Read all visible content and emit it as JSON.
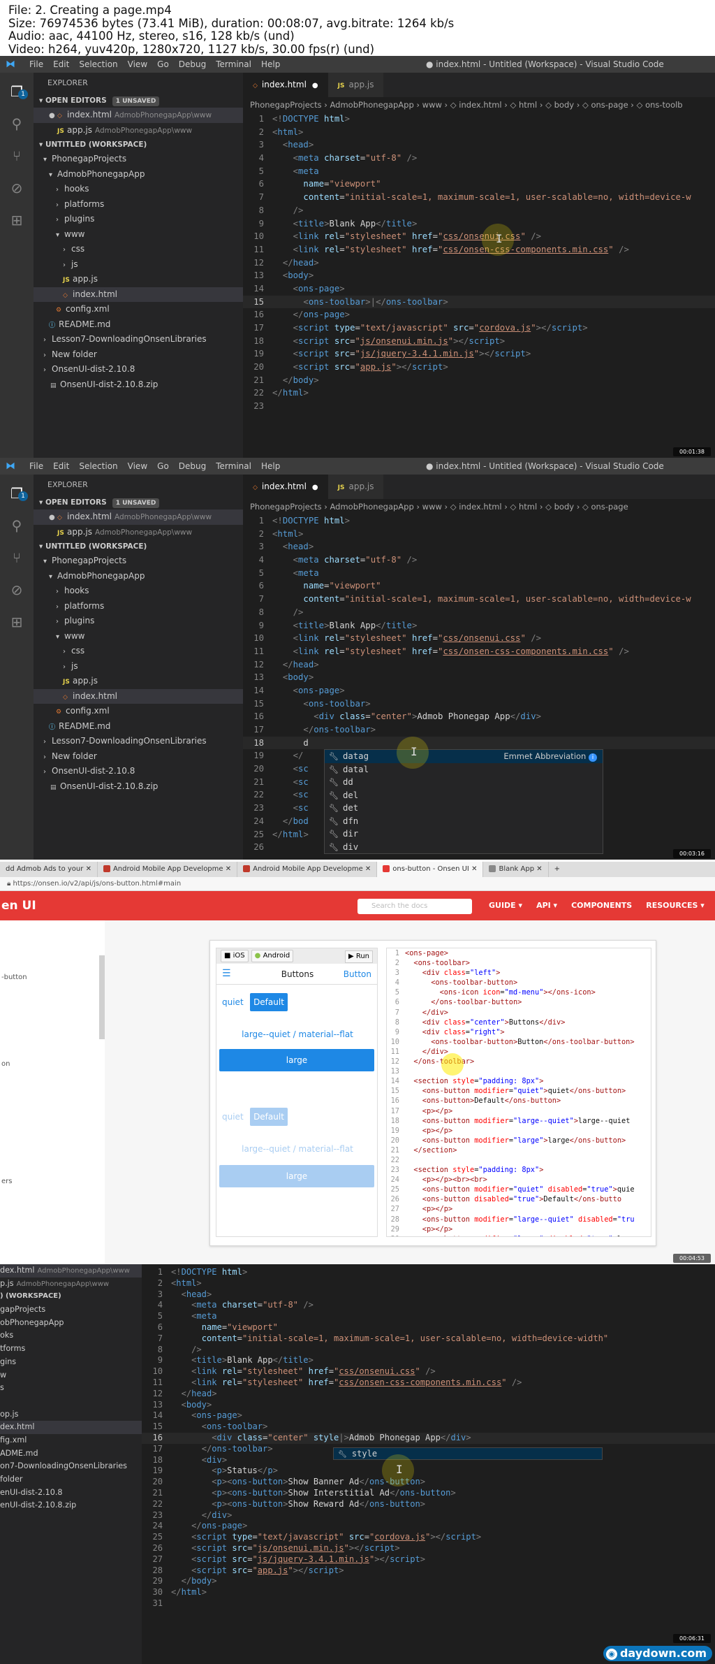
{
  "info": {
    "line1": "File: 2. Creating a page.mp4",
    "line2": "Size: 76974536 bytes (73.41 MiB), duration: 00:08:07, avg.bitrate: 1264 kb/s",
    "line3": "Audio: aac, 44100 Hz, stereo, s16, 128 kb/s (und)",
    "line4": "Video: h264, yuv420p, 1280x720, 1127 kb/s, 30.00 fps(r) (und)"
  },
  "menu": [
    "File",
    "Edit",
    "Selection",
    "View",
    "Go",
    "Debug",
    "Terminal",
    "Help"
  ],
  "window_title": "● index.html - Untitled (Workspace) - Visual Studio Code",
  "explorer": {
    "header": "EXPLORER",
    "open_editors": "OPEN EDITORS",
    "unsaved": "1 UNSAVED",
    "workspace": "UNTITLED (WORKSPACE)",
    "open_files": [
      {
        "name": "index.html",
        "path": "AdmobPhonegapApp\\www"
      },
      {
        "name": "app.js",
        "path": "AdmobPhonegapApp\\www"
      }
    ],
    "tree": [
      "PhonegapProjects",
      "AdmobPhonegapApp",
      "hooks",
      "platforms",
      "plugins",
      "www",
      "css",
      "js",
      "app.js",
      "index.html",
      "config.xml",
      "README.md",
      "Lesson7-DownloadingOnsenLibraries",
      "New folder",
      "OnsenUI-dist-2.10.8",
      "OnsenUI-dist-2.10.8.zip"
    ]
  },
  "tabs": {
    "index": "index.html",
    "app": "app.js"
  },
  "breadcrumb1": "PhonegapProjects › AdmobPhonegapApp › www › ◇ index.html › ◇ html › ◇ body › ◇ ons-page › ◇ ons-toolb",
  "breadcrumb2": "PhonegapProjects › AdmobPhonegapApp › www › ◇ index.html › ◇ html › ◇ body › ◇ ons-page",
  "autocomplete": {
    "items": [
      "datag",
      "datal",
      "dd",
      "del",
      "det",
      "dfn",
      "dir",
      "div"
    ],
    "hint": "Emmet Abbreviation"
  },
  "stamps": [
    "00:01:38",
    "00:03:16",
    "00:04:53",
    "00:06:31"
  ],
  "browser": {
    "tabs": [
      "dd Admob Ads to your",
      "Android Mobile App Developme",
      "Android Mobile App Developme",
      "ons-button - Onsen UI",
      "Blank App"
    ],
    "url": "https://onsen.io/v2/api/js/ons-button.html#main",
    "brand": "en UI",
    "search_placeholder": "Search the docs",
    "nav": [
      "GUIDE ▾",
      "API ▾",
      "COMPONENTS",
      "RESOURCES ▾"
    ],
    "left_links": [
      "-button",
      "on",
      "ers"
    ],
    "phone": {
      "ios": "iOS",
      "android": "Android",
      "run": "▶ Run",
      "title": "Buttons",
      "right": "Button",
      "quiet": "quiet",
      "default": "Default",
      "lq": "large--quiet / material--flat",
      "large": "large",
      "quiet_d": "quiet",
      "default_d": "Default",
      "lq_d": "large--quiet / material--flat",
      "large_d": "large"
    }
  },
  "watermark": "daydown.com"
}
